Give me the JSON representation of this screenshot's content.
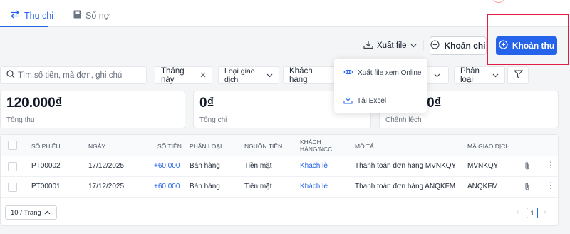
{
  "tabs": [
    {
      "label": "Thu chi",
      "icon": "swap-arrows-icon",
      "active": true
    },
    {
      "label": "Sổ nợ",
      "icon": "book-icon",
      "active": false
    }
  ],
  "toolbar": {
    "export_label": "Xuất file",
    "expense_label": "Khoản chi",
    "income_label": "Khoản thu"
  },
  "export_menu": [
    {
      "label": "Xuất file xem Online",
      "icon": "eye-icon"
    },
    {
      "label": "Tải Excel",
      "icon": "download-icon"
    }
  ],
  "filters": {
    "search_placeholder": "Tìm số tiền, mã đơn, ghi chú",
    "month": "Tháng này",
    "transaction_type": "Loại giao dịch",
    "customer": "Khách hàng",
    "category": "Phân loại"
  },
  "stats": [
    {
      "value": "120.000₫",
      "label": "Tổng thu"
    },
    {
      "value": "0₫",
      "label": "Tổng chi"
    },
    {
      "value": "120.000₫",
      "label": "Chênh lệch"
    }
  ],
  "table": {
    "columns": [
      "Số phiếu",
      "Ngày",
      "Số tiền",
      "Phân loại",
      "Nguồn tiền",
      "Khách hàng/NCC",
      "Mô tả",
      "Mã giao dịch"
    ],
    "rows": [
      [
        "PT00002",
        "17/12/2025",
        "+60.000",
        "Bán hàng",
        "Tiền mặt",
        "Khách lẻ",
        "Thanh toán đơn hàng MVNKQY",
        "MVNKQY"
      ],
      [
        "PT00001",
        "17/12/2025",
        "+60.000",
        "Bán hàng",
        "Tiền mặt",
        "Khách lẻ",
        "Thanh toán đơn hàng ANQKFM",
        "ANQKFM"
      ]
    ]
  },
  "pagination": {
    "page_size_label": "10 / Trang",
    "current_page": "1"
  },
  "colors": {
    "primary": "#2563eb",
    "highlight": "#e11d48"
  }
}
